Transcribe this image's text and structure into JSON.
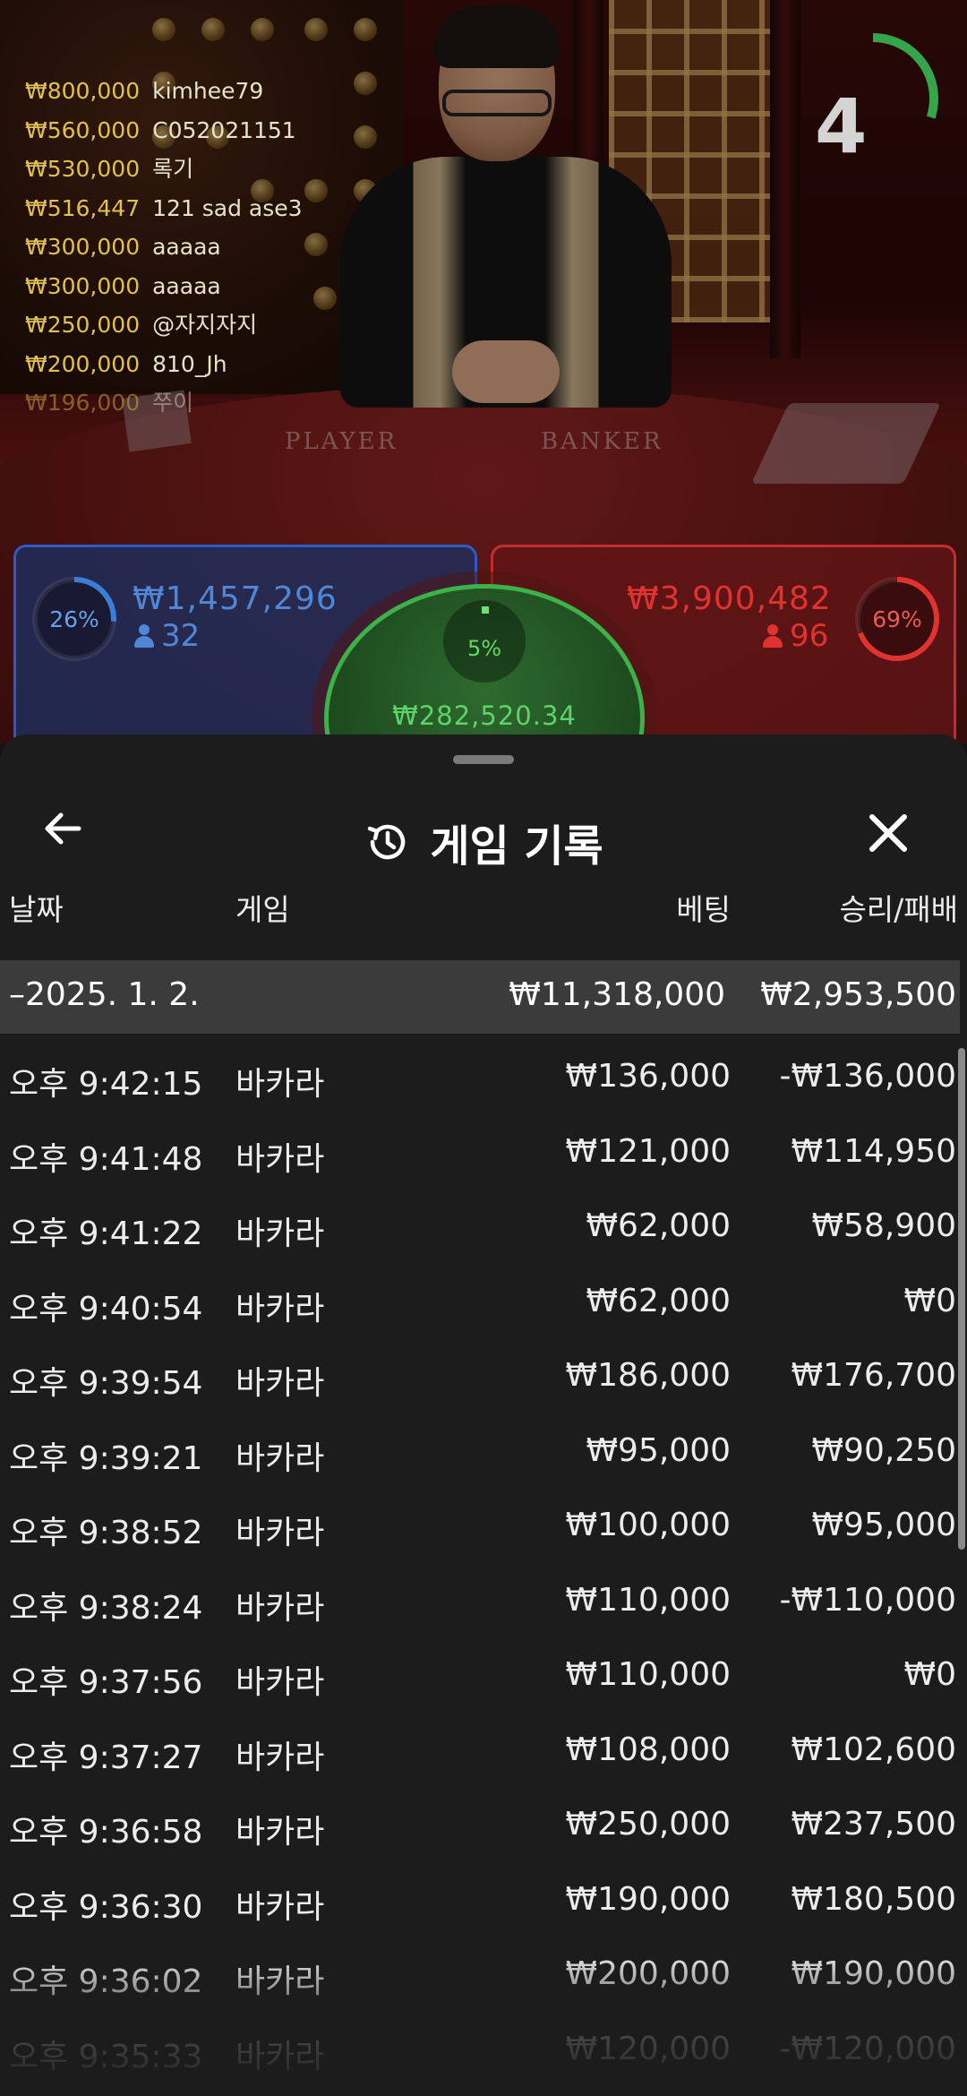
{
  "chat": [
    {
      "amount": "₩800,000",
      "name": "kimhee79"
    },
    {
      "amount": "₩560,000",
      "name": "C052021151"
    },
    {
      "amount": "₩530,000",
      "name": "록기"
    },
    {
      "amount": "₩516,447",
      "name": "121 sad ase3"
    },
    {
      "amount": "₩300,000",
      "name": "aaaaa"
    },
    {
      "amount": "₩300,000",
      "name": "aaaaa"
    },
    {
      "amount": "₩250,000",
      "name": "@자지자지"
    },
    {
      "amount": "₩200,000",
      "name": "810_Jh"
    },
    {
      "amount": "₩196,000",
      "name": "쭈이"
    }
  ],
  "timer": {
    "value": "4",
    "fraction": 0.3,
    "color": "#35a44a"
  },
  "table": {
    "player_label": "PLAYER",
    "banker_label": "BANKER"
  },
  "betting": {
    "player": {
      "percent": "26%",
      "fraction": 0.26,
      "amount": "₩1,457,296",
      "count": "32",
      "color": "#3b7ed8"
    },
    "banker": {
      "percent": "69%",
      "fraction": 0.69,
      "amount": "₩3,900,482",
      "count": "96",
      "color": "#e0332f"
    },
    "tie": {
      "percent": "5%",
      "fraction": 0.05,
      "amount": "₩282,520.34",
      "color": "#5fd36a"
    }
  },
  "sheet": {
    "title": "게임 기록",
    "columns": {
      "date": "날짜",
      "game": "게임",
      "bet": "베팅",
      "win_loss": "승리/패배"
    },
    "group": {
      "date": "–2025. 1. 2.",
      "bet": "₩11,318,000",
      "win_loss": "₩2,953,500"
    },
    "rows": [
      {
        "time": "오후 9:42:15",
        "game": "바카라",
        "bet": "₩136,000",
        "result": "-₩136,000"
      },
      {
        "time": "오후 9:41:48",
        "game": "바카라",
        "bet": "₩121,000",
        "result": "₩114,950"
      },
      {
        "time": "오후 9:41:22",
        "game": "바카라",
        "bet": "₩62,000",
        "result": "₩58,900"
      },
      {
        "time": "오후 9:40:54",
        "game": "바카라",
        "bet": "₩62,000",
        "result": "₩0"
      },
      {
        "time": "오후 9:39:54",
        "game": "바카라",
        "bet": "₩186,000",
        "result": "₩176,700"
      },
      {
        "time": "오후 9:39:21",
        "game": "바카라",
        "bet": "₩95,000",
        "result": "₩90,250"
      },
      {
        "time": "오후 9:38:52",
        "game": "바카라",
        "bet": "₩100,000",
        "result": "₩95,000"
      },
      {
        "time": "오후 9:38:24",
        "game": "바카라",
        "bet": "₩110,000",
        "result": "-₩110,000"
      },
      {
        "time": "오후 9:37:56",
        "game": "바카라",
        "bet": "₩110,000",
        "result": "₩0"
      },
      {
        "time": "오후 9:37:27",
        "game": "바카라",
        "bet": "₩108,000",
        "result": "₩102,600"
      },
      {
        "time": "오후 9:36:58",
        "game": "바카라",
        "bet": "₩250,000",
        "result": "₩237,500"
      },
      {
        "time": "오후 9:36:30",
        "game": "바카라",
        "bet": "₩190,000",
        "result": "₩180,500"
      },
      {
        "time": "오후 9:36:02",
        "game": "바카라",
        "bet": "₩200,000",
        "result": "₩190,000"
      },
      {
        "time": "오후 9:35:33",
        "game": "바카라",
        "bet": "₩120,000",
        "result": "-₩120,000"
      }
    ]
  },
  "icons": {
    "back": "arrow-left-icon",
    "history": "history-icon",
    "close": "close-icon",
    "person": "person-icon"
  }
}
